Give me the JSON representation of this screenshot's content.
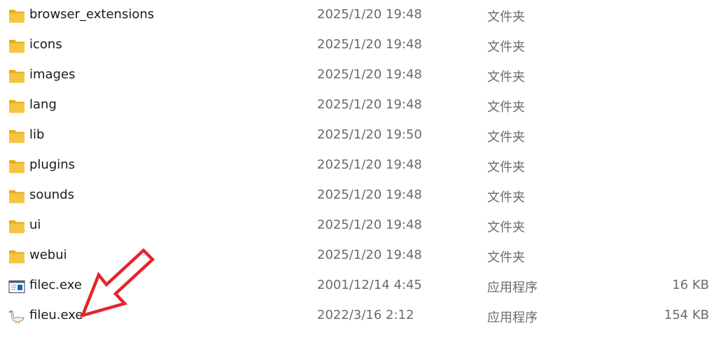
{
  "file_list": {
    "items": [
      {
        "name": "browser_extensions",
        "date": "2025/1/20 19:48",
        "type": "文件夹",
        "size": "",
        "icon": "folder-icon"
      },
      {
        "name": "icons",
        "date": "2025/1/20 19:48",
        "type": "文件夹",
        "size": "",
        "icon": "folder-icon"
      },
      {
        "name": "images",
        "date": "2025/1/20 19:48",
        "type": "文件夹",
        "size": "",
        "icon": "folder-icon"
      },
      {
        "name": "lang",
        "date": "2025/1/20 19:48",
        "type": "文件夹",
        "size": "",
        "icon": "folder-icon"
      },
      {
        "name": "lib",
        "date": "2025/1/20 19:50",
        "type": "文件夹",
        "size": "",
        "icon": "folder-icon"
      },
      {
        "name": "plugins",
        "date": "2025/1/20 19:48",
        "type": "文件夹",
        "size": "",
        "icon": "folder-icon"
      },
      {
        "name": "sounds",
        "date": "2025/1/20 19:48",
        "type": "文件夹",
        "size": "",
        "icon": "folder-icon"
      },
      {
        "name": "ui",
        "date": "2025/1/20 19:48",
        "type": "文件夹",
        "size": "",
        "icon": "folder-icon"
      },
      {
        "name": "webui",
        "date": "2025/1/20 19:48",
        "type": "文件夹",
        "size": "",
        "icon": "folder-icon"
      },
      {
        "name": "filec.exe",
        "date": "2001/12/14 4:45",
        "type": "应用程序",
        "size": "16 KB",
        "icon": "window-app-icon"
      },
      {
        "name": "fileu.exe",
        "date": "2022/3/16 2:12",
        "type": "应用程序",
        "size": "154 KB",
        "icon": "goose-app-icon"
      }
    ]
  },
  "colors": {
    "folder": "#f5c542",
    "folder_dark": "#e8ab17",
    "arrow": "#e5252a",
    "secondary_text": "#6b6b6b"
  }
}
